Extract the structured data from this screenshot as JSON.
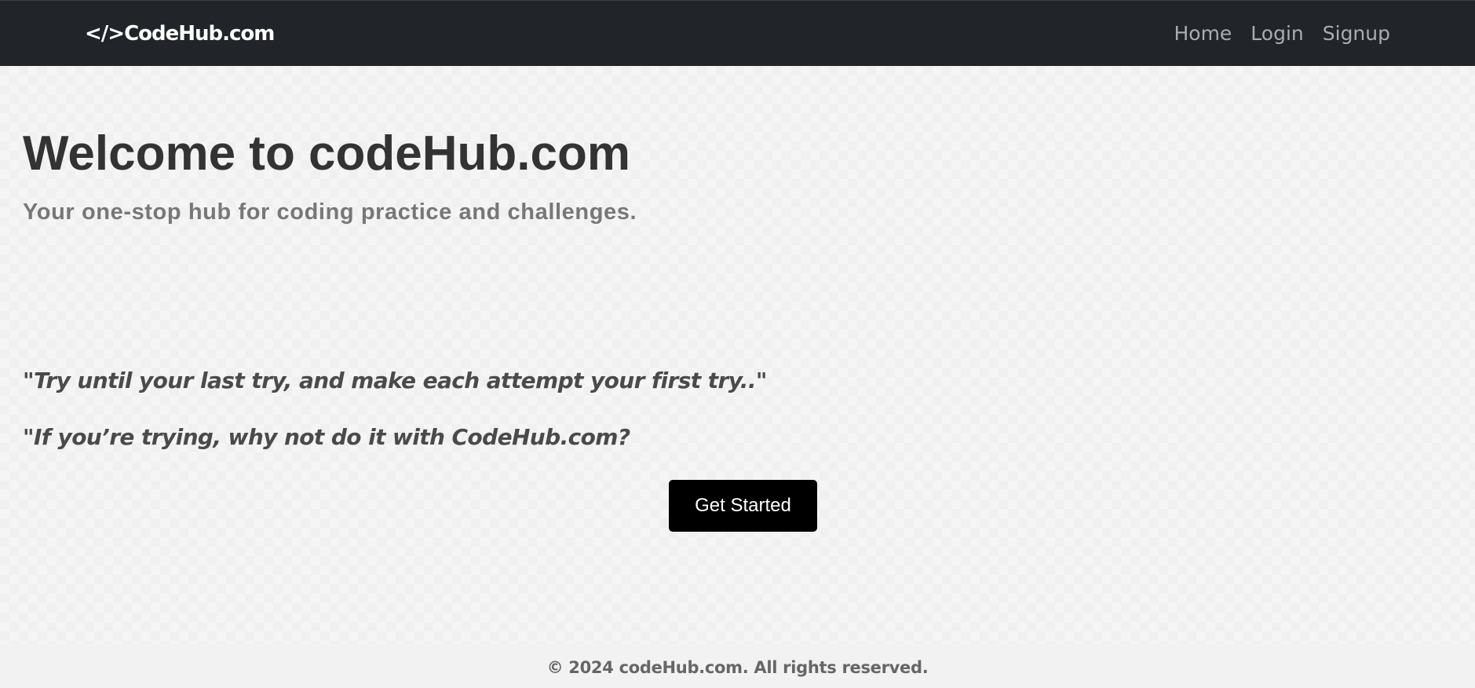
{
  "navbar": {
    "brand": "</>CodeHub.com",
    "links": [
      {
        "label": "Home"
      },
      {
        "label": "Login"
      },
      {
        "label": "Signup"
      }
    ]
  },
  "hero": {
    "title": "Welcome to codeHub.com",
    "subtitle": "Your one-stop hub for coding practice and challenges."
  },
  "quotes": [
    "\"Try until your last try, and make each attempt your first try..\"",
    "\"If you’re trying, why not do it with CodeHub.com?"
  ],
  "cta": {
    "label": "Get Started"
  },
  "footer": {
    "text": "© 2024 codeHub.com. All rights reserved."
  }
}
